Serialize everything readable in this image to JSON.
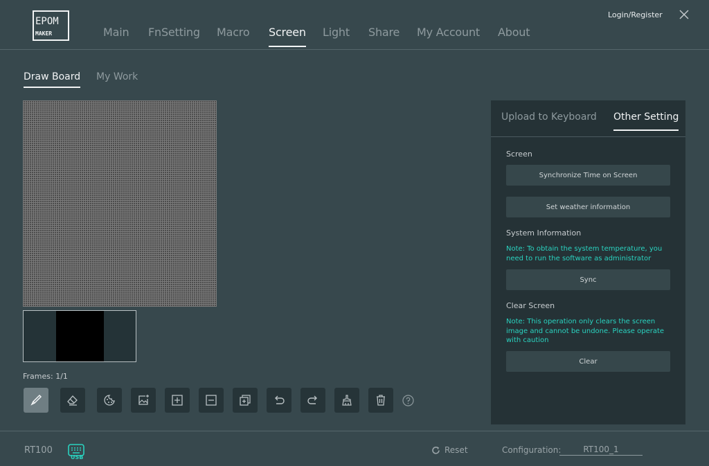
{
  "brand": {
    "logo_top": "EPOM",
    "logo_bottom": "MAKER"
  },
  "nav": {
    "items": [
      {
        "label": "Main"
      },
      {
        "label": "FnSetting"
      },
      {
        "label": "Macro"
      },
      {
        "label": "Screen",
        "active": true
      },
      {
        "label": "Light"
      },
      {
        "label": "Share"
      },
      {
        "label": "My Account"
      },
      {
        "label": "About"
      }
    ],
    "login_label": "Login/Register"
  },
  "subtabs": [
    {
      "label": "Draw Board",
      "active": true
    },
    {
      "label": "My Work"
    }
  ],
  "frames": {
    "label": "Frames: 1/1",
    "current": 1,
    "total": 1
  },
  "toolbar": {
    "tools": [
      {
        "name": "brush-icon",
        "active": true
      },
      {
        "name": "eraser-icon"
      },
      {
        "name": "palette-icon"
      },
      {
        "name": "image-add-icon"
      },
      {
        "name": "add-frame-icon"
      },
      {
        "name": "remove-frame-icon"
      },
      {
        "name": "copy-frame-icon"
      },
      {
        "name": "undo-icon"
      },
      {
        "name": "redo-icon"
      },
      {
        "name": "clear-brush-icon"
      },
      {
        "name": "trash-icon"
      }
    ]
  },
  "panel": {
    "tabs": [
      {
        "label": "Upload to Keyboard"
      },
      {
        "label": "Other Setting",
        "active": true
      }
    ],
    "screen_section": "Screen",
    "sync_time_button": "Synchronize Time on Screen",
    "weather_button": "Set weather information",
    "system_section": "System Information",
    "system_note": "Note: To obtain the system temperature, you need to run the software as administrator",
    "sync_button": "Sync",
    "clear_section": "Clear Screen",
    "clear_note": "Note: This operation only clears the screen image and cannot be undone. Please operate with caution",
    "clear_button": "Clear"
  },
  "footer": {
    "model": "RT100",
    "connection": "USB",
    "reset_label": "Reset",
    "config_label": "Configuration:",
    "config_value": "RT100_1"
  },
  "colors": {
    "accent": "#2ad3c0",
    "background": "#37484d",
    "panel": "#253236"
  }
}
